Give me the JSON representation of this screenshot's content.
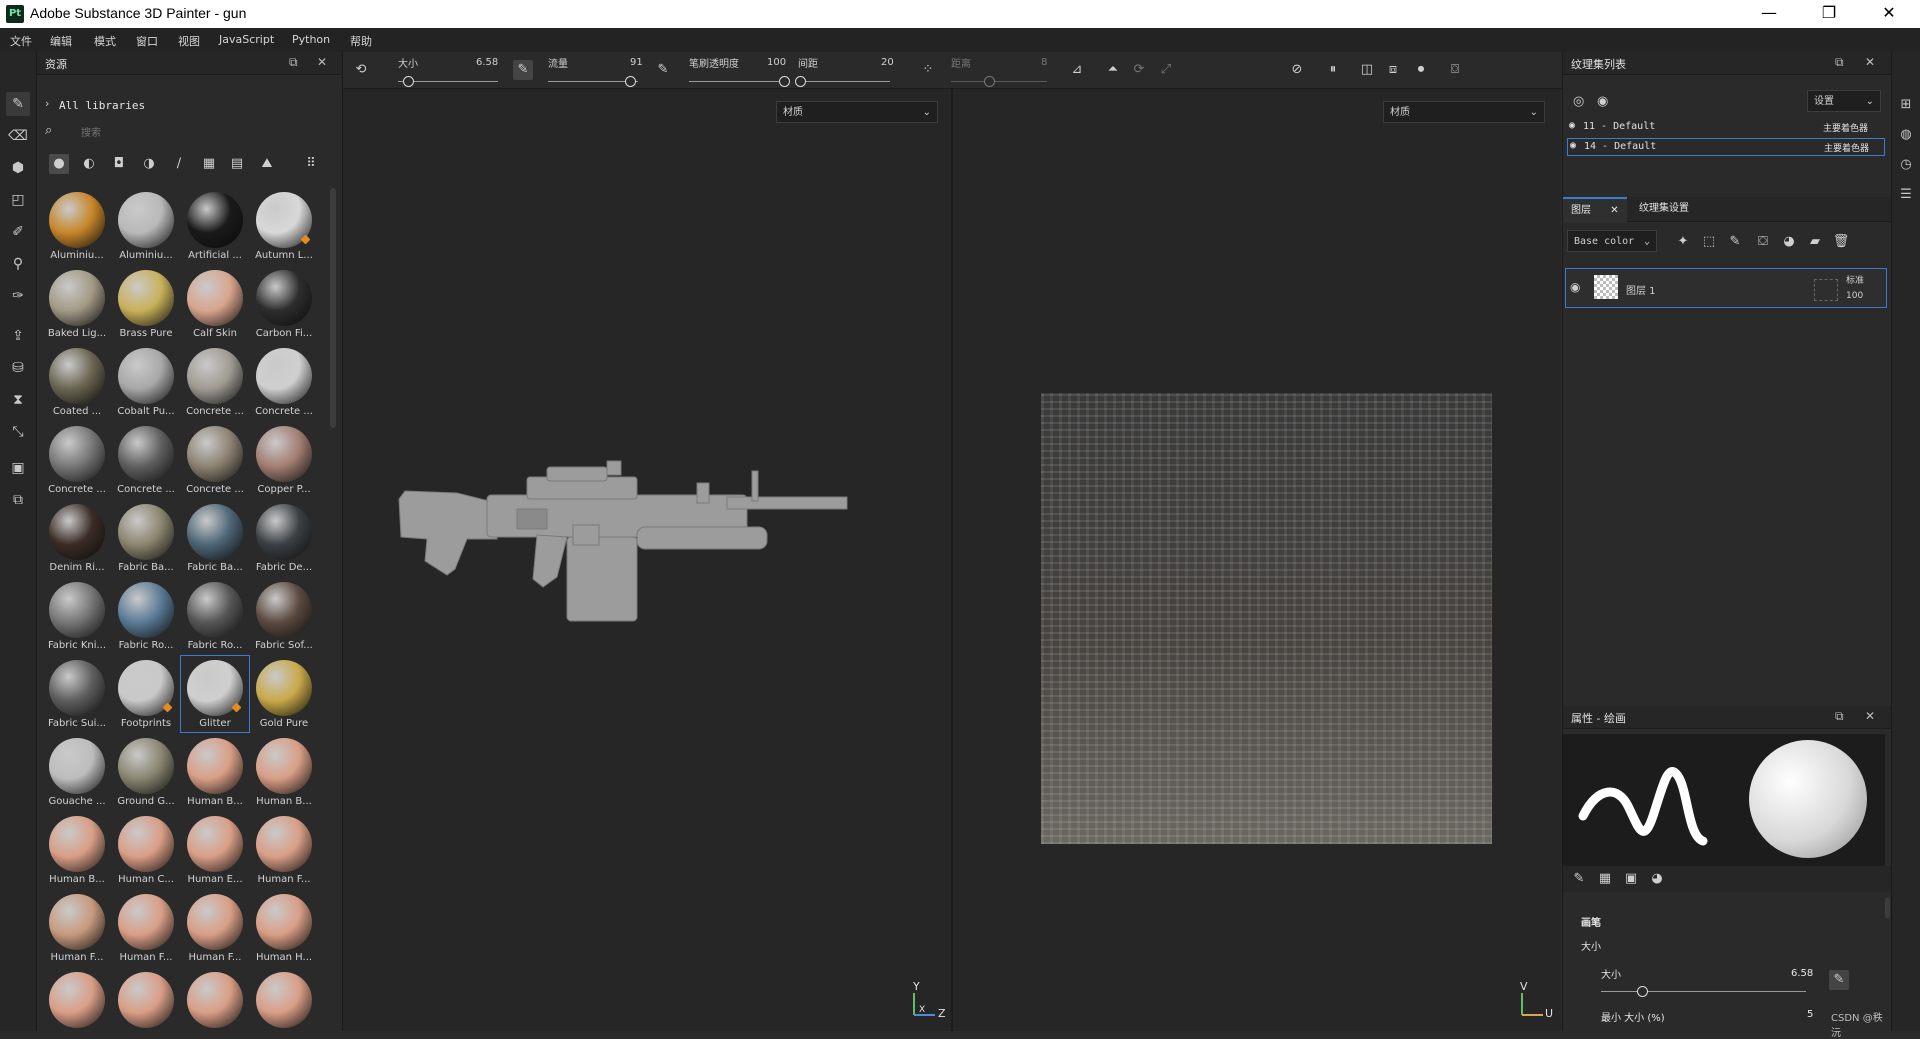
{
  "window": {
    "title": "Adobe Substance 3D Painter - gun",
    "app_icon": "Pt",
    "minimize": "—",
    "maximize": "❐",
    "close": "✕"
  },
  "menu": [
    "文件",
    "编辑",
    "模式",
    "窗口",
    "视图",
    "JavaScript",
    "Python",
    "帮助"
  ],
  "assets": {
    "title": "资源",
    "library": "All libraries",
    "search_placeholder": "搜索",
    "items": [
      {
        "label": "Aluminiu...",
        "color": "#c8862a"
      },
      {
        "label": "Aluminiu...",
        "color": "#b9b9b9"
      },
      {
        "label": "Artificial ...",
        "color": "#1a1a1a"
      },
      {
        "label": "Autumn L...",
        "color": "#d8d8d8",
        "badge": true
      },
      {
        "label": "Baked Lig...",
        "color": "#a39a86"
      },
      {
        "label": "Brass Pure",
        "color": "#c9b15a"
      },
      {
        "label": "Calf Skin",
        "color": "#d8a58d"
      },
      {
        "label": "Carbon Fi...",
        "color": "#2d2d2d"
      },
      {
        "label": "Coated ...",
        "color": "#6b6652"
      },
      {
        "label": "Cobalt Pu...",
        "color": "#a8a8a8"
      },
      {
        "label": "Concrete ...",
        "color": "#a09c94"
      },
      {
        "label": "Concrete ...",
        "color": "#cfcfcf"
      },
      {
        "label": "Concrete ...",
        "color": "#777777"
      },
      {
        "label": "Concrete ...",
        "color": "#5f5f5f"
      },
      {
        "label": "Concrete ...",
        "color": "#8c8272"
      },
      {
        "label": "Copper P...",
        "color": "#a37e73"
      },
      {
        "label": "Denim Ri...",
        "color": "#3a2c25"
      },
      {
        "label": "Fabric Ba...",
        "color": "#8b8670"
      },
      {
        "label": "Fabric Ba...",
        "color": "#4e6677"
      },
      {
        "label": "Fabric De...",
        "color": "#3b4044"
      },
      {
        "label": "Fabric Kni...",
        "color": "#767676"
      },
      {
        "label": "Fabric Ro...",
        "color": "#5a7a96"
      },
      {
        "label": "Fabric Ro...",
        "color": "#565656"
      },
      {
        "label": "Fabric Sof...",
        "color": "#5b4a40"
      },
      {
        "label": "Fabric Sui...",
        "color": "#5e5e5e"
      },
      {
        "label": "Footprints",
        "color": "#c9c9c9",
        "badge": true
      },
      {
        "label": "Glitter",
        "color": "#cfcfcf",
        "badge": true,
        "selected": true
      },
      {
        "label": "Gold Pure",
        "color": "#c9a94a"
      },
      {
        "label": "Gouache ...",
        "color": "#bdbdbd"
      },
      {
        "label": "Ground G...",
        "color": "#8a8672"
      },
      {
        "label": "Human B...",
        "color": "#d99e86"
      },
      {
        "label": "Human B...",
        "color": "#d99e86"
      },
      {
        "label": "Human B...",
        "color": "#d99e86"
      },
      {
        "label": "Human C...",
        "color": "#d99e86"
      },
      {
        "label": "Human E...",
        "color": "#d99e86"
      },
      {
        "label": "Human F...",
        "color": "#d99e86"
      },
      {
        "label": "Human F...",
        "color": "#c79a7e"
      },
      {
        "label": "Human F...",
        "color": "#d99e86"
      },
      {
        "label": "Human F...",
        "color": "#d99e86"
      },
      {
        "label": "Human H...",
        "color": "#d99e86"
      },
      {
        "label": "",
        "color": "#d99e86"
      },
      {
        "label": "",
        "color": "#d99e86"
      },
      {
        "label": "",
        "color": "#d99e86"
      },
      {
        "label": "",
        "color": "#d99e86"
      }
    ]
  },
  "toolbar": {
    "size_label": "大小",
    "size_value": "6.58",
    "flow_label": "流量",
    "flow_value": "91",
    "opacity_label": "笔刷透明度",
    "opacity_value": "100",
    "spacing_label": "间距",
    "spacing_value": "20",
    "distance_label": "距离",
    "distance_value": "8",
    "sliders": {
      "size": 0.1,
      "flow": 0.91,
      "opacity": 1.0,
      "spacing": 0.0,
      "distance": 0.4
    }
  },
  "viewport3d": {
    "material_mode": "材质",
    "axes": {
      "y": "Y",
      "x": "X",
      "z": "Z"
    }
  },
  "viewport2d": {
    "material_mode": "材质",
    "axes": {
      "v": "V",
      "u": "U"
    }
  },
  "texture_set_list": {
    "title": "纹理集列表",
    "settings": "设置",
    "rows": [
      {
        "name": "11 - Default",
        "shader": "主要着色器"
      },
      {
        "name": "14 - Default",
        "shader": "主要着色器",
        "selected": true
      }
    ]
  },
  "layers": {
    "tab_layers": "图层",
    "tab_texture_set_settings": "纹理集设置",
    "channel": "Base color",
    "layer_name": "图层 1",
    "blend_mode": "标准",
    "opacity": "100"
  },
  "properties": {
    "title": "属性 - 绘画",
    "brush_section": "画笔",
    "size_label": "大小",
    "size_sub_label": "大小",
    "size_value": "6.58",
    "size_slider": 0.2,
    "min_size_label": "最小 大小 (%)",
    "min_size_value": "5"
  },
  "watermark": "CSDN @秩沅"
}
